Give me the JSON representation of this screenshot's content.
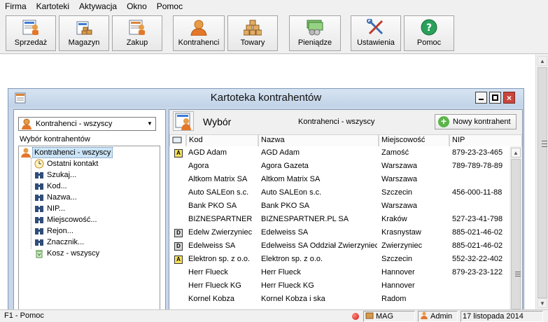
{
  "menu": [
    "Firma",
    "Kartoteki",
    "Aktywacja",
    "Okno",
    "Pomoc"
  ],
  "toolbar": {
    "buttons": [
      {
        "label": "Sprzedaż",
        "icon": "sales-icon"
      },
      {
        "label": "Magazyn",
        "icon": "warehouse-icon"
      },
      {
        "label": "Zakup",
        "icon": "purchase-icon"
      },
      {
        "label": "Kontrahenci",
        "icon": "contractors-icon"
      },
      {
        "label": "Towary",
        "icon": "goods-icon"
      },
      {
        "label": "Pieniądze",
        "icon": "money-icon"
      },
      {
        "label": "Ustawienia",
        "icon": "settings-icon"
      },
      {
        "label": "Pomoc",
        "icon": "help-icon"
      }
    ]
  },
  "window": {
    "title": "Kartoteka kontrahentów",
    "buttons": {
      "minimize": "minimize-icon",
      "maximize": "maximize-icon",
      "close": "×"
    }
  },
  "left": {
    "combo_value": "Kontrahenci - wszyscy",
    "section_label": "Wybór kontrahentów",
    "tree": [
      {
        "label": "Kontrahenci - wszyscy",
        "icon": "person-icon",
        "selected": true
      },
      {
        "label": "Ostatni kontakt",
        "icon": "clock-icon"
      },
      {
        "label": "Szukaj...",
        "icon": "binoculars-icon"
      },
      {
        "label": "Kod...",
        "icon": "binoculars-icon"
      },
      {
        "label": "Nazwa...",
        "icon": "binoculars-icon"
      },
      {
        "label": "NIP...",
        "icon": "binoculars-icon"
      },
      {
        "label": "Miejscowość...",
        "icon": "binoculars-icon"
      },
      {
        "label": "Rejon...",
        "icon": "binoculars-icon"
      },
      {
        "label": "Znacznik...",
        "icon": "binoculars-icon"
      },
      {
        "label": "Kosz - wszyscy",
        "icon": "recycle-bin-icon"
      }
    ]
  },
  "right": {
    "header_title": "Wybór",
    "context_label": "Kontrahenci - wszyscy",
    "new_button": "Nowy kontrahent",
    "columns": [
      "Kod",
      "Nazwa",
      "Miejscowość",
      "NIP"
    ],
    "rows": [
      {
        "badge": "A",
        "kod": "AGD Adam",
        "nazwa": "AGD Adam",
        "miejscowosc": "Zamość",
        "nip": "879-23-23-465"
      },
      {
        "badge": "",
        "kod": "Agora",
        "nazwa": "Agora Gazeta",
        "miejscowosc": "Warszawa",
        "nip": "789-789-78-89"
      },
      {
        "badge": "",
        "kod": "Altkom Matrix SA",
        "nazwa": "Altkom Matrix SA",
        "miejscowosc": "Warszawa",
        "nip": ""
      },
      {
        "badge": "",
        "kod": "Auto SALEon s.c.",
        "nazwa": "Auto SALEon s.c.",
        "miejscowosc": "Szczecin",
        "nip": "456-000-11-88"
      },
      {
        "badge": "",
        "kod": "Bank PKO SA",
        "nazwa": "Bank PKO SA",
        "miejscowosc": "Warszawa",
        "nip": ""
      },
      {
        "badge": "",
        "kod": "BIZNESPARTNER",
        "nazwa": "BIZNESPARTNER.PL SA",
        "miejscowosc": "Kraków",
        "nip": "527-23-41-798"
      },
      {
        "badge": "D",
        "kod": "Edelw Zwierzyniec",
        "nazwa": "Edelweiss SA",
        "miejscowosc": "Krasnystaw",
        "nip": "885-021-46-02"
      },
      {
        "badge": "D",
        "kod": "Edelweiss SA",
        "nazwa": "Edelweiss SA Oddział Zwierzyniec",
        "miejscowosc": "Zwierzyniec",
        "nip": "885-021-46-02"
      },
      {
        "badge": "A",
        "kod": "Elektron sp. z o.o.",
        "nazwa": "Elektron sp. z o.o.",
        "miejscowosc": "Szczecin",
        "nip": "552-32-22-402"
      },
      {
        "badge": "",
        "kod": "Herr Flueck",
        "nazwa": "Herr Flueck",
        "miejscowosc": "Hannover",
        "nip": "879-23-23-122"
      },
      {
        "badge": "",
        "kod": "Herr Flueck KG",
        "nazwa": "Herr Flueck KG",
        "miejscowosc": "Hannover",
        "nip": ""
      },
      {
        "badge": "",
        "kod": "Kornel Kobza",
        "nazwa": "Kornel Kobza i ska",
        "miejscowosc": "Radom",
        "nip": ""
      }
    ]
  },
  "status": {
    "help": "F1 - Pomoc",
    "warehouse": "MAG",
    "user": "Admin",
    "date": "17 listopada 2014"
  },
  "colors": {
    "title_bar": "#c8d6e8",
    "close_button": "#c9463d",
    "badge_a": "#f6e25c",
    "badge_d": "#d8d8d8",
    "selection": "#cce4f7"
  }
}
